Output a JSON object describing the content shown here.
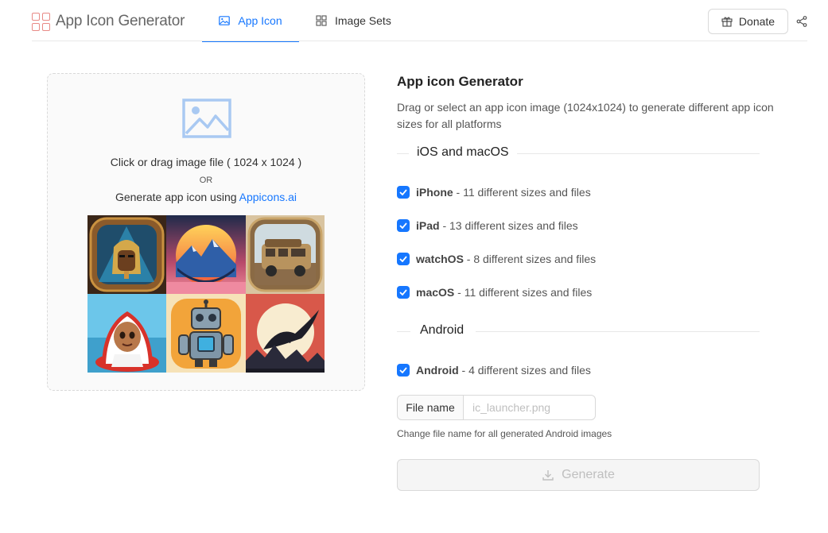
{
  "brand": {
    "title": "App Icon Generator",
    "logo_icon": "grid-logo-icon"
  },
  "nav": {
    "tabs": [
      {
        "label": "App Icon",
        "icon": "picture-icon",
        "active": true
      },
      {
        "label": "Image Sets",
        "icon": "grid-icon",
        "active": false
      }
    ]
  },
  "header_actions": {
    "donate_label": "Donate",
    "donate_icon": "gift-icon",
    "share_icon": "share-icon"
  },
  "upload": {
    "icon": "image-placeholder-icon",
    "instruction": "Click or drag image file ( 1024 x 1024 )",
    "or": "OR",
    "generate_prefix": "Generate app icon using ",
    "generate_link": "Appicons.ai",
    "samples": [
      "pharaoh-icon",
      "mountain-sunset-icon",
      "camper-van-icon",
      "nun-avatar-icon",
      "robot-icon",
      "eagle-sunset-icon"
    ]
  },
  "panel": {
    "title": "App icon Generator",
    "description": "Drag or select an app icon image (1024x1024) to generate different app icon sizes for all platforms",
    "ios_section": "iOS and macOS",
    "android_section": "Android",
    "ios_options": [
      {
        "name": "iPhone",
        "desc": " - 11 different sizes and files",
        "checked": true
      },
      {
        "name": "iPad",
        "desc": " - 13 different sizes and files",
        "checked": true
      },
      {
        "name": "watchOS",
        "desc": " - 8 different sizes and files",
        "checked": true
      },
      {
        "name": "macOS",
        "desc": " - 11 different sizes and files",
        "checked": true
      }
    ],
    "android_options": [
      {
        "name": "Android",
        "desc": " - 4 different sizes and files",
        "checked": true
      }
    ],
    "filename_label": "File name",
    "filename_placeholder": "ic_launcher.png",
    "filename_value": "",
    "filename_hint": "Change file name for all generated Android images",
    "generate_label": "Generate",
    "generate_icon": "download-icon"
  },
  "colors": {
    "accent": "#1677ff",
    "logo": "#e88a86",
    "border": "#d9d9d9"
  }
}
